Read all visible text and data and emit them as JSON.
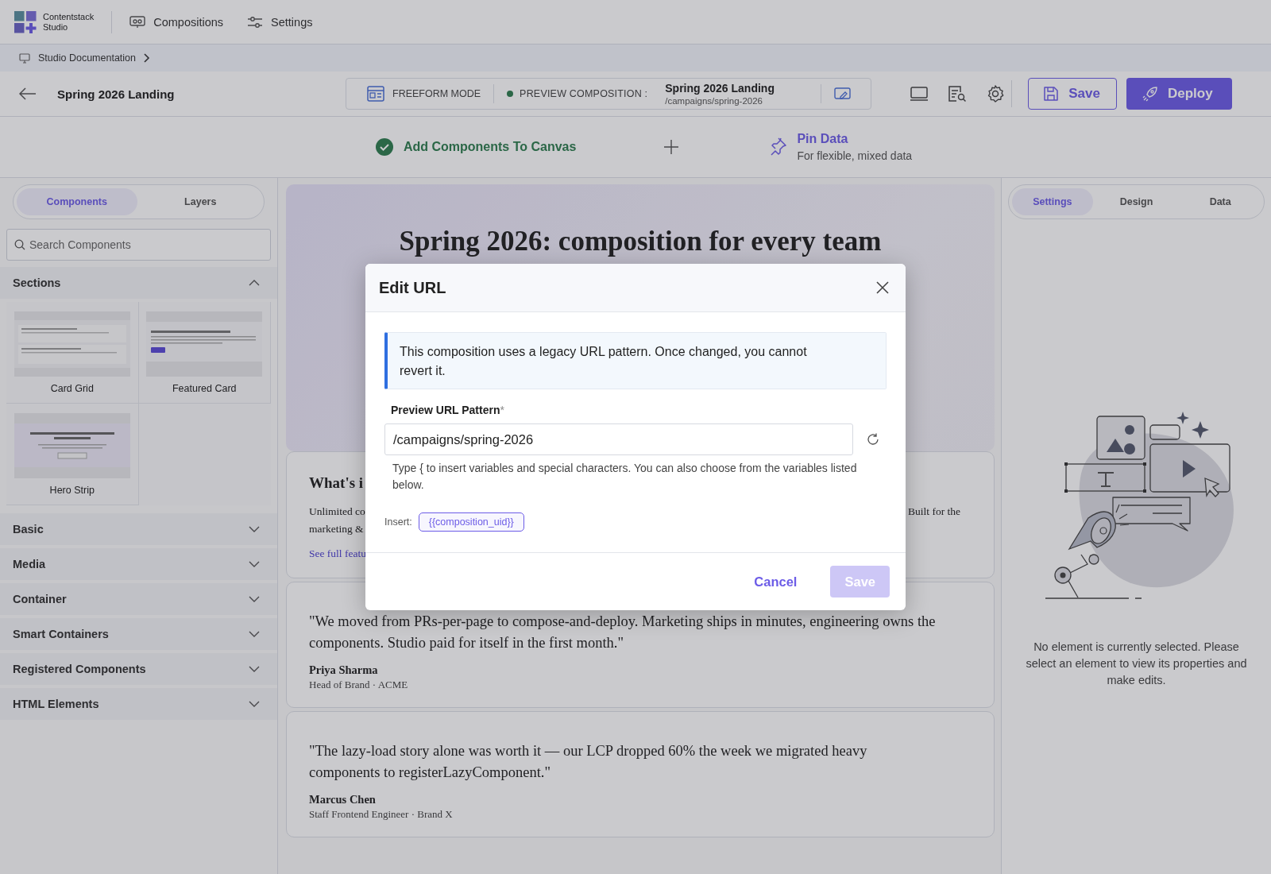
{
  "top_nav": {
    "logo": {
      "name": "Contentstack",
      "subtitle": "Studio"
    },
    "items": [
      {
        "label": "Compositions"
      },
      {
        "label": "Settings"
      }
    ]
  },
  "breadcrumb": {
    "items": [
      "Studio Documentation"
    ]
  },
  "header": {
    "title": "Spring 2026 Landing",
    "mode": "FREEFORM MODE",
    "preview_label": "PREVIEW COMPOSITION :",
    "preview_title": "Spring 2026 Landing",
    "preview_path": "/campaigns/spring-2026",
    "buttons": [
      {
        "label": "Save",
        "kind": "outline"
      },
      {
        "label": "Deploy",
        "kind": "primary"
      }
    ]
  },
  "steps": [
    {
      "label": "Add Components To Canvas",
      "done": true
    },
    {
      "label": "Pin Data",
      "subtitle": "For flexible, mixed data",
      "done": false
    }
  ],
  "left_panel": {
    "tabs": [
      {
        "label": "Components",
        "selected": true
      },
      {
        "label": "Layers",
        "selected": false
      }
    ],
    "search": {
      "placeholder": "Search Components"
    },
    "groups": [
      {
        "label": "Sections",
        "expanded": true,
        "components": [
          {
            "label": "Card Grid",
            "kind": "cards"
          },
          {
            "label": "Featured Card",
            "kind": "featured"
          },
          {
            "label": "Hero Strip",
            "kind": "hero"
          }
        ]
      },
      {
        "label": "Basic",
        "expanded": false
      },
      {
        "label": "Media",
        "expanded": false
      },
      {
        "label": "Container",
        "expanded": false
      },
      {
        "label": "Smart Containers",
        "expanded": false
      },
      {
        "label": "Registered Components",
        "expanded": false
      },
      {
        "label": "HTML Elements",
        "expanded": false
      }
    ]
  },
  "canvas": {
    "hero_heading": "Spring 2026: composition for every team",
    "feature_card": {
      "heading": "What's i",
      "line_1_start": "Unlimited co",
      "line_1_end": "Built for the",
      "line_2": "marketing &",
      "link": "See full featu"
    },
    "testimonials": [
      {
        "quote": "\"We moved from PRs-per-page to compose-and-deploy. Marketing ships in minutes, engineering owns the components. Studio paid for itself in the first month.\"",
        "name": "Priya Sharma",
        "role": "Head of Brand · ACME"
      },
      {
        "quote": "\"The lazy-load story alone was worth it — our LCP dropped 60% the week we migrated heavy components to registerLazyComponent.\"",
        "name": "Marcus Chen",
        "role": "Staff Frontend Engineer · Brand X"
      }
    ]
  },
  "right_panel": {
    "tabs": [
      {
        "label": "Settings",
        "selected": true
      },
      {
        "label": "Design",
        "selected": false
      },
      {
        "label": "Data",
        "selected": false
      }
    ],
    "empty_message": "No element is currently selected. Please select an element to view its properties and make edits."
  },
  "dialog": {
    "title": "Edit URL",
    "notice": "This composition uses a legacy URL pattern. Once changed, you cannot revert it.",
    "field_label": "Preview URL Pattern",
    "required_mark": "*",
    "value": "/campaigns/spring-2026",
    "hint": "Type { to insert variables and special characters. You can also choose from the variables listed below.",
    "insert_label": "Insert:",
    "variables": [
      "{{composition_uid}}"
    ],
    "buttons": [
      {
        "label": "Cancel",
        "kind": "text",
        "disabled": false
      },
      {
        "label": "Save",
        "kind": "primary",
        "disabled": true
      }
    ]
  }
}
